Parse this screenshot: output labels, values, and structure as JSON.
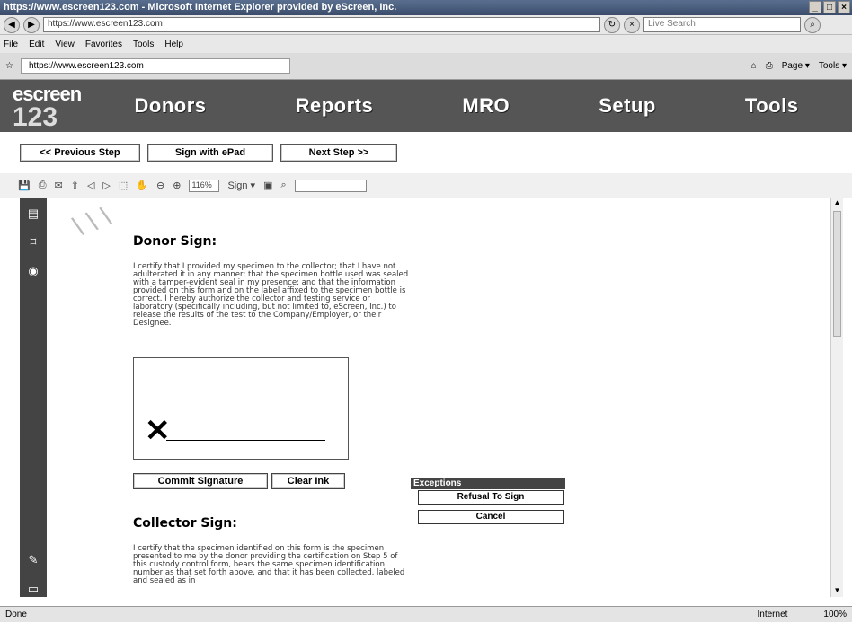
{
  "window": {
    "title": "https://www.escreen123.com - Microsoft Internet Explorer provided by eScreen, Inc."
  },
  "address": {
    "url": "https://www.escreen123.com",
    "search_placeholder": "Live Search"
  },
  "menu": [
    "File",
    "Edit",
    "View",
    "Favorites",
    "Tools",
    "Help"
  ],
  "tab": {
    "label": "https://www.escreen123.com",
    "page_label": "Page ▾",
    "tools_label": "Tools ▾"
  },
  "app": {
    "logo_top": "escreen",
    "logo_bottom": "123"
  },
  "nav": [
    "Donors",
    "Reports",
    "MRO",
    "Setup",
    "Tools"
  ],
  "steps": {
    "previous": "<< Previous Step",
    "sign_epad": "Sign with ePad",
    "next": "Next Step >>"
  },
  "pdf_toolbar": {
    "zoom": "116%",
    "sign_label": "Sign ▾"
  },
  "document": {
    "donor_title": "Donor Sign:",
    "donor_text": "I certify that I provided my specimen to the collector; that I have not adulterated it in any manner; that the specimen bottle used was sealed with a tamper-evident seal in my presence; and that the information provided on this form and on the label affixed to the specimen bottle is correct. I hereby authorize the collector and testing service or laboratory (specifically including, but not limited to, eScreen, Inc.) to release the results of the test to the Company/Employer, or their Designee.",
    "commit_label": "Commit Signature",
    "clear_label": "Clear Ink",
    "exceptions_label": "Exceptions",
    "refusal_label": "Refusal To Sign",
    "cancel_label": "Cancel",
    "collector_title": "Collector Sign:",
    "collector_text": "I certify that the specimen identified on this form is the specimen presented to me by the donor providing the certification on Step 5 of this custody control form, bears the same specimen identification number as that set forth above, and that it has been collected, labeled and sealed as in"
  },
  "status": {
    "left": "Done",
    "zone": "Internet",
    "zoom": "100%"
  }
}
